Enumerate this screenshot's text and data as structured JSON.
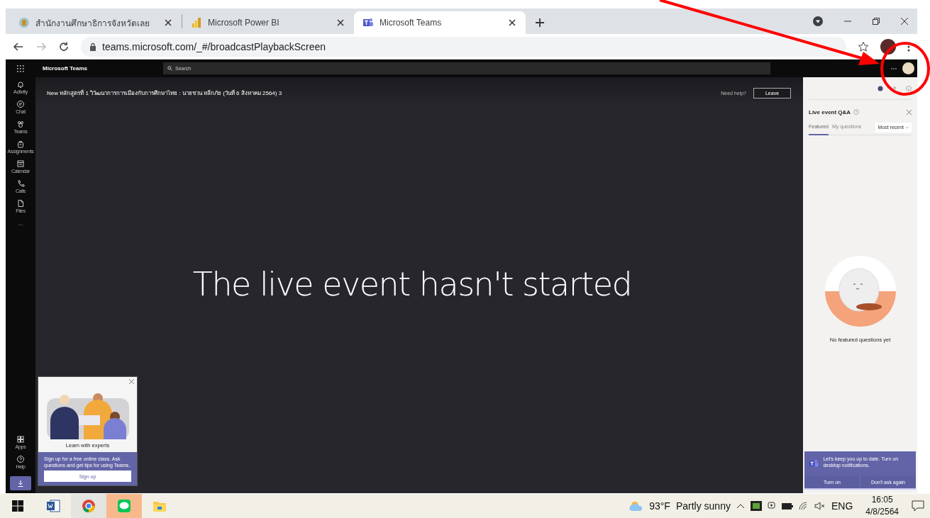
{
  "browser": {
    "tabs": [
      {
        "title": "สำนักงานศึกษาธิการจังหวัดเลย",
        "selected": false
      },
      {
        "title": "Microsoft Power BI",
        "selected": false
      },
      {
        "title": "Microsoft Teams",
        "selected": true
      }
    ],
    "url": "teams.microsoft.com/_#/broadcastPlaybackScreen"
  },
  "teams": {
    "app_name": "Microsoft Teams",
    "search": {
      "placeholder": "Search"
    },
    "rail": [
      {
        "label": "Activity"
      },
      {
        "label": "Chat"
      },
      {
        "label": "Teams"
      },
      {
        "label": "Assignments"
      },
      {
        "label": "Calendar"
      },
      {
        "label": "Calls"
      },
      {
        "label": "Files"
      }
    ],
    "rail_more": "...",
    "rail_bottom": [
      {
        "label": "Apps"
      },
      {
        "label": "Help"
      }
    ],
    "event_title": "New หลักสูตรที่ 1 วิวัฒนาการการเมืองกับการศึกษาไทย : นายชวน หลีกภัย (วันที่ 6 สิงหาคม 2564) 3",
    "help_link": "Need help?",
    "leave_button": "Leave",
    "message": "The live event hasn't started",
    "promo": {
      "title": "Learn with experts",
      "text": "Sign up for a free online class. Ask questions and get tips for using Teams.",
      "button": "Sign up"
    },
    "qa": {
      "title": "Live event Q&A",
      "tabs": [
        {
          "label": "Featured",
          "selected": true
        },
        {
          "label": "My questions",
          "selected": false
        }
      ],
      "sort": "Most recent",
      "empty": "No featured questions yet",
      "notification": {
        "text": "Let's keep you up to date. Turn on desktop notifications.",
        "buttons": [
          "Turn on",
          "Don't ask again"
        ]
      }
    }
  },
  "taskbar": {
    "apps": [
      {
        "kind": "word",
        "active": false,
        "flashing": false
      },
      {
        "kind": "chrome",
        "active": true,
        "flashing": false
      },
      {
        "kind": "line",
        "active": false,
        "flashing": true
      },
      {
        "kind": "explorer",
        "active": false,
        "flashing": false
      }
    ],
    "temperature": "93°F",
    "weather": "Partly sunny",
    "language": "ENG",
    "time": "16:05",
    "date": "4/8/2564"
  }
}
